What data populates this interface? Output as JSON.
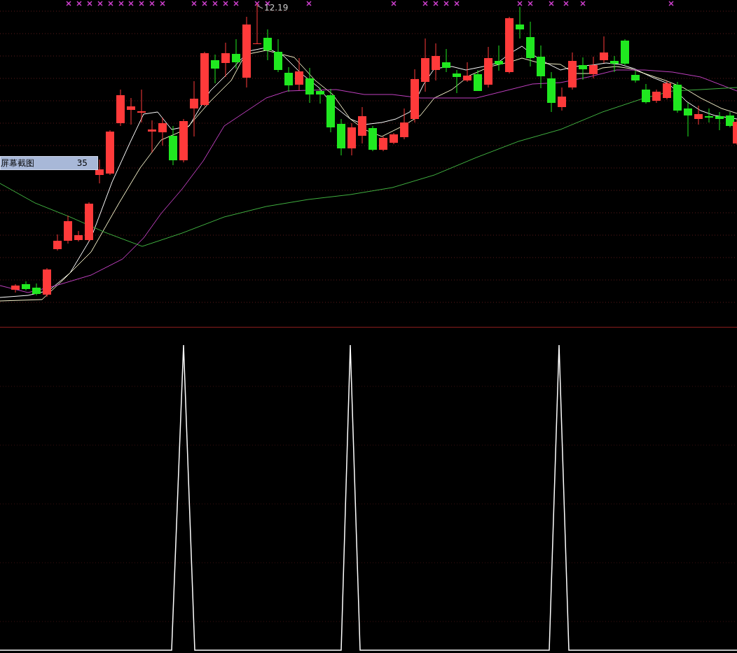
{
  "price_chart": {
    "high_label": "12.19",
    "tooltip": {
      "label": "屏幕截图",
      "value": "35"
    }
  }
}
